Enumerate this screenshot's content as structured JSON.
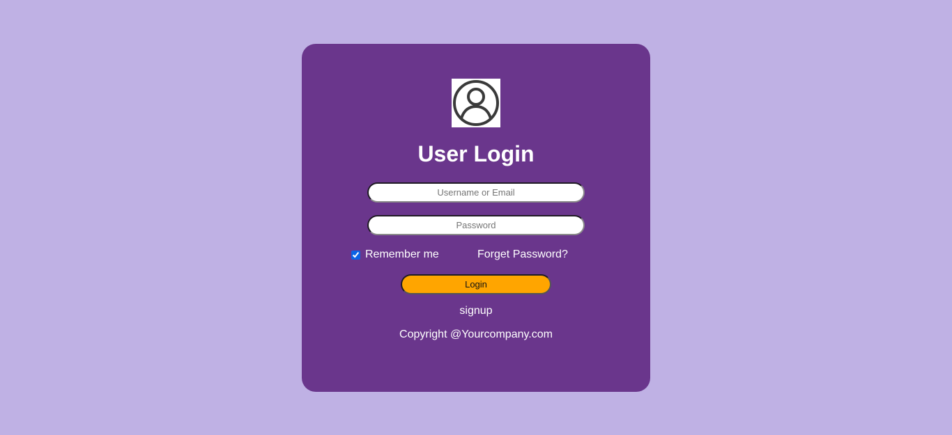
{
  "colors": {
    "page_background": "#bfb1e4",
    "card_background": "#6a368c",
    "login_button": "#ffa500",
    "text": "#ffffff"
  },
  "login": {
    "avatar_icon": "user-circle-icon",
    "title": "User Login",
    "username_placeholder": "Username or Email",
    "username_value": "",
    "password_placeholder": "Password",
    "password_value": "",
    "remember_label": "Remember me",
    "remember_checked": true,
    "forgot_label": "Forget Password?",
    "login_label": "Login",
    "signup_label": "signup",
    "copyright": "Copyright @Yourcompany.com"
  }
}
